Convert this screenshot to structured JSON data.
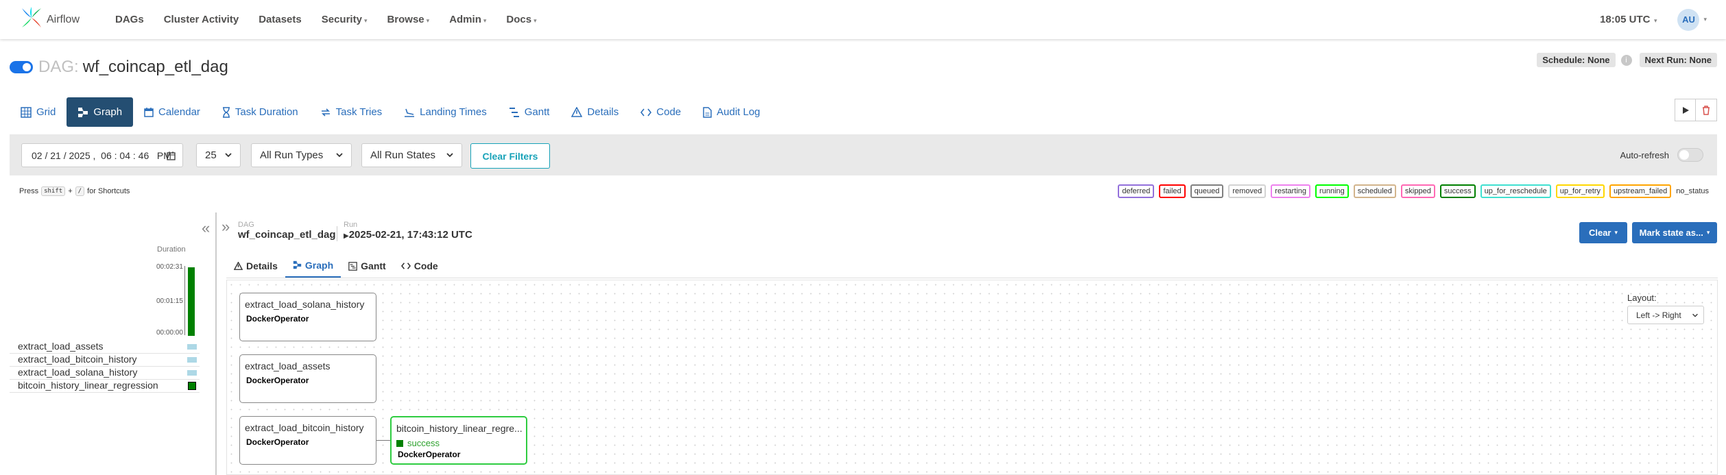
{
  "navbar": {
    "brand": "Airflow",
    "items": [
      {
        "label": "DAGs",
        "dropdown": false
      },
      {
        "label": "Cluster Activity",
        "dropdown": false
      },
      {
        "label": "Datasets",
        "dropdown": false
      },
      {
        "label": "Security",
        "dropdown": true
      },
      {
        "label": "Browse",
        "dropdown": true
      },
      {
        "label": "Admin",
        "dropdown": true
      },
      {
        "label": "Docs",
        "dropdown": true
      }
    ],
    "time": "18:05 UTC",
    "user_initials": "AU"
  },
  "dag": {
    "prefix": "DAG:",
    "name": "wf_coincap_etl_dag",
    "schedule": "Schedule: None",
    "next_run": "Next Run: None"
  },
  "view_tabs": [
    "Grid",
    "Graph",
    "Calendar",
    "Task Duration",
    "Task Tries",
    "Landing Times",
    "Gantt",
    "Details",
    "Code",
    "Audit Log"
  ],
  "filters": {
    "date": "02 / 21 / 2025 ,  06 : 04 : 46   PM",
    "num_runs": "25",
    "run_types": "All Run Types",
    "run_states": "All Run States",
    "clear_filters": "Clear Filters",
    "auto_refresh": "Auto-refresh"
  },
  "shortcuts": {
    "press": "Press",
    "key1": "shift",
    "plus": "+",
    "key2": "/",
    "suffix": "for Shortcuts"
  },
  "legend": [
    {
      "label": "deferred",
      "color": "#9370db"
    },
    {
      "label": "failed",
      "color": "#ff0000"
    },
    {
      "label": "queued",
      "color": "#808080"
    },
    {
      "label": "removed",
      "color": "#d3d3d3"
    },
    {
      "label": "restarting",
      "color": "#ee82ee"
    },
    {
      "label": "running",
      "color": "#00ff00"
    },
    {
      "label": "scheduled",
      "color": "#d2b48c"
    },
    {
      "label": "skipped",
      "color": "#ff69b4"
    },
    {
      "label": "success",
      "color": "#008000"
    },
    {
      "label": "up_for_reschedule",
      "color": "#40e0d0"
    },
    {
      "label": "up_for_retry",
      "color": "#ffd700"
    },
    {
      "label": "upstream_failed",
      "color": "#ffa500"
    },
    {
      "label": "no_status",
      "color": ""
    }
  ],
  "grid": {
    "duration_label": "Duration",
    "ticks": [
      "00:02:31",
      "00:01:15",
      "00:00:00"
    ],
    "tasks": [
      {
        "name": "extract_load_assets",
        "status": "no_status"
      },
      {
        "name": "extract_load_bitcoin_history",
        "status": "no_status"
      },
      {
        "name": "extract_load_solana_history",
        "status": "no_status"
      },
      {
        "name": "bitcoin_history_linear_regression",
        "status": "success"
      }
    ]
  },
  "details": {
    "crumb_dag_label": "DAG",
    "crumb_dag": "wf_coincap_etl_dag",
    "crumb_run_label": "Run",
    "crumb_run": "2025-02-21, 17:43:12 UTC",
    "clear_button": "Clear",
    "mark_button": "Mark state as...",
    "tabs": [
      "Details",
      "Graph",
      "Gantt",
      "Code"
    ]
  },
  "graph": {
    "layout_label": "Layout:",
    "layout_value": "Left -> Right",
    "nodes": [
      {
        "title": "extract_load_solana_history",
        "operator": "DockerOperator",
        "status": ""
      },
      {
        "title": "extract_load_assets",
        "operator": "DockerOperator",
        "status": ""
      },
      {
        "title": "extract_load_bitcoin_history",
        "operator": "DockerOperator",
        "status": ""
      },
      {
        "title": "bitcoin_history_linear_regre...",
        "operator": "DockerOperator",
        "status": "success"
      }
    ]
  }
}
